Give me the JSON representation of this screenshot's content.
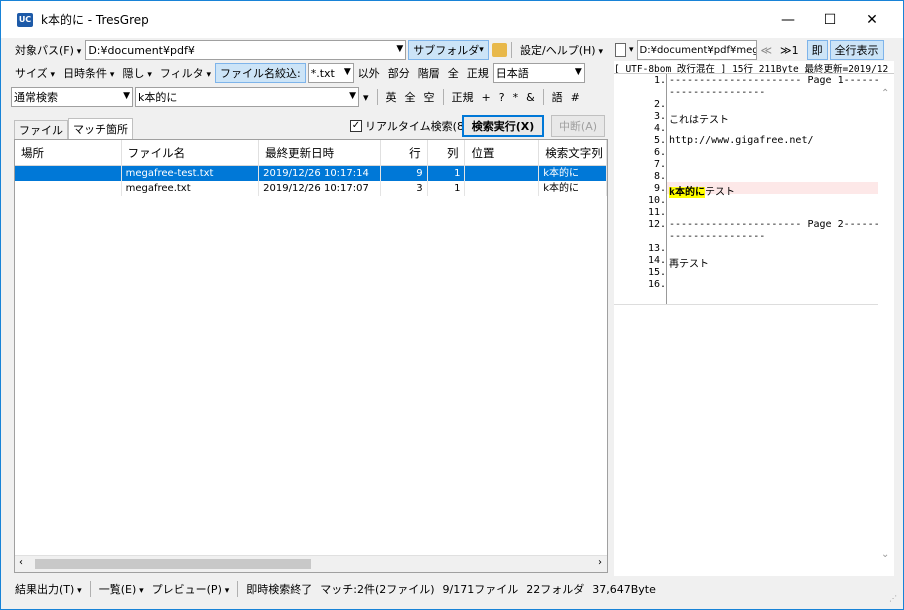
{
  "titlebar": {
    "icon": "UC",
    "title": "k本的に - TresGrep",
    "minimize": "—",
    "maximize": "☐",
    "close": "✕"
  },
  "toolbar1": {
    "target_label": "対象パス(F)",
    "path": "D:¥document¥pdf¥",
    "subfolder": "サブフォルダ",
    "settings": "設定/ヘルプ(H)"
  },
  "toolbar2": {
    "size": "サイズ",
    "datetime": "日時条件",
    "hidden": "隠し",
    "filter": "フィルタ",
    "filename_filter": "ファイル名絞込:",
    "ext": "*.txt",
    "except": "以外",
    "part": "部分",
    "level": "階層",
    "all": "全",
    "regex": "正規",
    "lang": "日本語"
  },
  "toolbar3": {
    "mode": "通常検索",
    "query": "k本的に",
    "chars": [
      "英",
      "全",
      "空"
    ],
    "regex": "正規",
    "symbols": [
      "+",
      "?",
      "*",
      "&"
    ],
    "word": "語",
    "hash": "#"
  },
  "tabs": [
    {
      "label": "ファイル"
    },
    {
      "label": "マッチ箇所"
    }
  ],
  "search": {
    "realtime": "リアルタイム検索(8)",
    "run": "検索実行(X)",
    "stop": "中断(A)"
  },
  "grid": {
    "headers": [
      "場所",
      "ファイル名",
      "最終更新日時",
      "行",
      "列",
      "位置",
      "検索文字列"
    ],
    "rows": [
      {
        "place": "",
        "file": "megafree-test.txt",
        "date": "2019/12/26 10:17:14",
        "line": "9",
        "col": "1",
        "pos": "",
        "text": "k本的に"
      },
      {
        "place": "",
        "file": "megafree.txt",
        "date": "2019/12/26 10:17:07",
        "line": "3",
        "col": "1",
        "pos": "",
        "text": "k本的に"
      }
    ]
  },
  "preview": {
    "path": "D:¥document¥pdf¥megafr",
    "prev": "≪",
    "next": "≫1",
    "immediate": "即",
    "allrows": "全行表示",
    "info": "[ UTF-8bom 改行混在 ] 15行 211Byte 最終更新=2019/12",
    "lines": [
      {
        "n": "1.",
        "t": "---------------------- Page 1-------"
      },
      {
        "n": "",
        "t": "----------------"
      },
      {
        "n": "2.",
        "t": ""
      },
      {
        "n": "3.",
        "t": "これはテスト"
      },
      {
        "n": "4.",
        "t": ""
      },
      {
        "n": "5.",
        "t": "http://www.gigafree.net/"
      },
      {
        "n": "6.",
        "t": ""
      },
      {
        "n": "7.",
        "t": ""
      },
      {
        "n": "8.",
        "t": ""
      },
      {
        "n": "9.",
        "t": "テスト",
        "hl": "k本的に"
      },
      {
        "n": "10.",
        "t": ""
      },
      {
        "n": "11.",
        "t": ""
      },
      {
        "n": "12.",
        "t": "---------------------- Page 2-------"
      },
      {
        "n": "",
        "t": "----------------"
      },
      {
        "n": "13.",
        "t": ""
      },
      {
        "n": "14.",
        "t": "再テスト"
      },
      {
        "n": "15.",
        "t": ""
      },
      {
        "n": "16.",
        "t": ""
      }
    ]
  },
  "status": {
    "export": "結果出力(T)",
    "list": "一覧(E)",
    "preview": "プレビュー(P)",
    "done": "即時検索終了",
    "match": "マッチ:2件(2ファイル)",
    "files": "9/171ファイル",
    "folders": "22フォルダ",
    "bytes": "37,647Byte"
  }
}
